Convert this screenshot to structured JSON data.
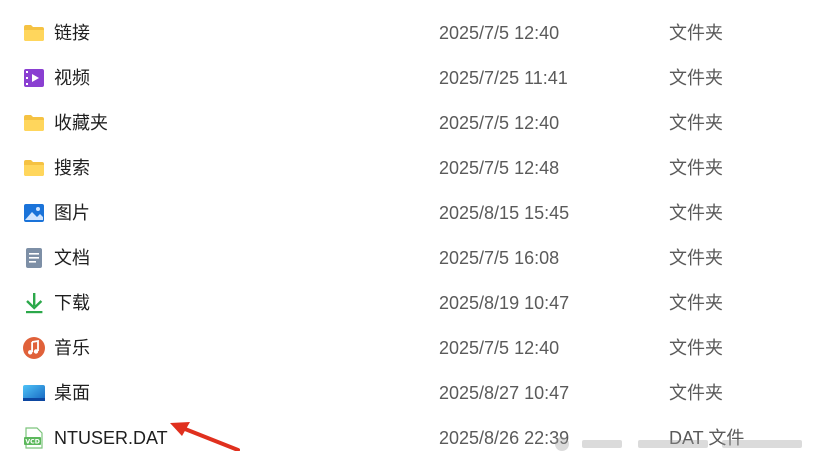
{
  "files": [
    {
      "name": "链接",
      "date": "2025/7/5 12:40",
      "type": "文件夹",
      "icon": "folder-icon"
    },
    {
      "name": "视频",
      "date": "2025/7/25 11:41",
      "type": "文件夹",
      "icon": "videos-folder-icon"
    },
    {
      "name": "收藏夹",
      "date": "2025/7/5 12:40",
      "type": "文件夹",
      "icon": "folder-icon"
    },
    {
      "name": "搜索",
      "date": "2025/7/5 12:48",
      "type": "文件夹",
      "icon": "folder-icon"
    },
    {
      "name": "图片",
      "date": "2025/8/15 15:45",
      "type": "文件夹",
      "icon": "pictures-folder-icon"
    },
    {
      "name": "文档",
      "date": "2025/7/5 16:08",
      "type": "文件夹",
      "icon": "documents-folder-icon"
    },
    {
      "name": "下载",
      "date": "2025/8/19 10:47",
      "type": "文件夹",
      "icon": "downloads-folder-icon"
    },
    {
      "name": "音乐",
      "date": "2025/7/5 12:40",
      "type": "文件夹",
      "icon": "music-folder-icon"
    },
    {
      "name": "桌面",
      "date": "2025/8/27 10:47",
      "type": "文件夹",
      "icon": "desktop-folder-icon"
    },
    {
      "name": "NTUSER.DAT",
      "date": "2025/8/26 22:39",
      "type": "DAT 文件",
      "icon": "vcd-file-icon"
    }
  ],
  "colors": {
    "folder": "#f5c242",
    "video": "#8a3fd1",
    "pictures": "#1a73d9",
    "downloads": "#2ba84a",
    "music": "#e0613a",
    "annotation_arrow": "#e0301e"
  }
}
